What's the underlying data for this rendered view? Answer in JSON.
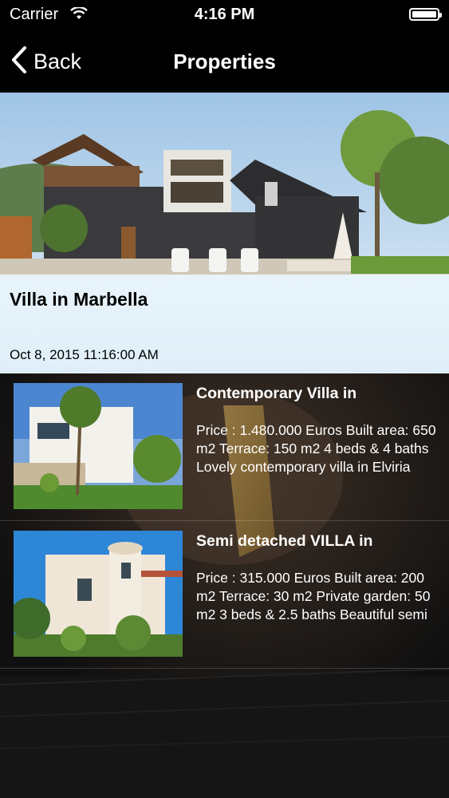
{
  "status_bar": {
    "carrier": "Carrier",
    "time": "4:16 PM",
    "wifi_icon": "wifi-icon",
    "battery_icon": "battery-icon"
  },
  "nav": {
    "back_label": "Back",
    "title": "Properties"
  },
  "featured": {
    "title": "Villa in Marbella",
    "date": "Oct 8, 2015 11:16:00 AM"
  },
  "listings": [
    {
      "title": "Contemporary Villa in",
      "description": "Price : 1.480.000  Euros Built area: 650 m2 Terrace: 150 m2 4 beds & 4 baths Lovely contemporary villa in Elviria"
    },
    {
      "title": "Semi detached VILLA in",
      "description": "Price : 315.000  Euros Built area: 200 m2 Terrace: 30 m2 Private garden: 50 m2 3 beds & 2.5 baths Beautiful semi"
    }
  ]
}
